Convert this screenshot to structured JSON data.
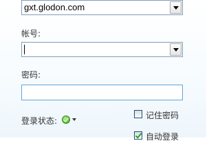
{
  "server": {
    "value": "gxt.glodon.com"
  },
  "account": {
    "label": "帐号:",
    "value": ""
  },
  "password": {
    "label": "密码:",
    "value": ""
  },
  "login_status": {
    "label": "登录状态:",
    "icon": "online-check-icon"
  },
  "remember_password": {
    "label": "记住密码",
    "checked": false
  },
  "auto_login": {
    "label": "自动登录",
    "checked": true
  },
  "colors": {
    "field_border": "#7f9db9",
    "focus_border": "#5fa7d6",
    "check_green": "#21a121"
  }
}
